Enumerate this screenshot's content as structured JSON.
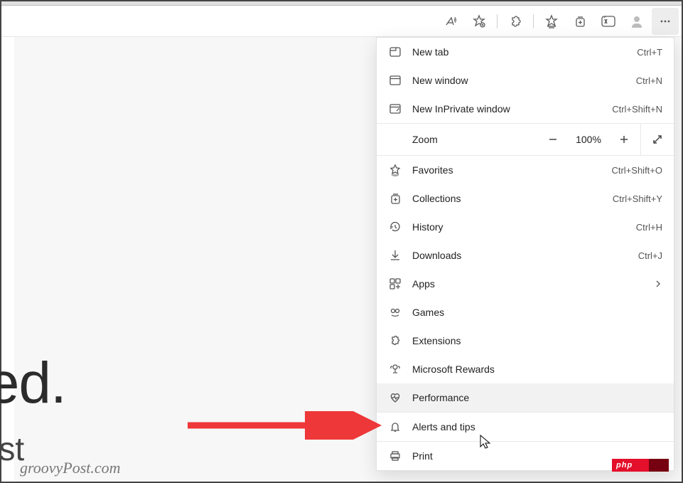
{
  "page": {
    "line1": "ted.",
    "line2": "first",
    "watermark": "groovyPost.com"
  },
  "badge": {
    "text": "php"
  },
  "zoom": {
    "label": "Zoom",
    "value": "100%"
  },
  "menu": [
    {
      "id": "new-tab",
      "label": "New tab",
      "shortcut": "Ctrl+T",
      "icon": "tab"
    },
    {
      "id": "new-window",
      "label": "New window",
      "shortcut": "Ctrl+N",
      "icon": "window"
    },
    {
      "id": "new-inprivate",
      "label": "New InPrivate window",
      "shortcut": "Ctrl+Shift+N",
      "icon": "inprivate"
    },
    {
      "id": "favorites",
      "label": "Favorites",
      "shortcut": "Ctrl+Shift+O",
      "icon": "star"
    },
    {
      "id": "collections",
      "label": "Collections",
      "shortcut": "Ctrl+Shift+Y",
      "icon": "collections"
    },
    {
      "id": "history",
      "label": "History",
      "shortcut": "Ctrl+H",
      "icon": "history"
    },
    {
      "id": "downloads",
      "label": "Downloads",
      "shortcut": "Ctrl+J",
      "icon": "download"
    },
    {
      "id": "apps",
      "label": "Apps",
      "shortcut": "",
      "icon": "apps",
      "submenu": true
    },
    {
      "id": "games",
      "label": "Games",
      "shortcut": "",
      "icon": "games"
    },
    {
      "id": "extensions",
      "label": "Extensions",
      "shortcut": "",
      "icon": "puzzle"
    },
    {
      "id": "rewards",
      "label": "Microsoft Rewards",
      "shortcut": "",
      "icon": "trophy"
    },
    {
      "id": "performance",
      "label": "Performance",
      "shortcut": "",
      "icon": "heart",
      "hover": true
    },
    {
      "id": "alerts",
      "label": "Alerts and tips",
      "shortcut": "",
      "icon": "bell"
    },
    {
      "id": "print",
      "label": "Print",
      "shortcut": "",
      "icon": "print"
    }
  ]
}
